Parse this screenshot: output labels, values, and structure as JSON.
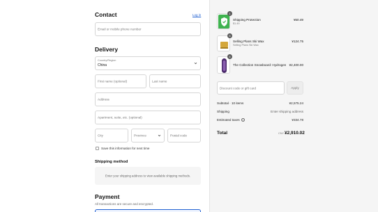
{
  "contact": {
    "heading": "Contact",
    "login_link": "Log in",
    "email_placeholder": "Email or mobile phone number"
  },
  "delivery": {
    "heading": "Delivery",
    "country_label": "Country/Region",
    "country_value": "China",
    "first_name_placeholder": "First name (optional)",
    "last_name_placeholder": "Last name",
    "address_placeholder": "Address",
    "apartment_placeholder": "Apartment, suite, etc. (optional)",
    "city_placeholder": "City",
    "province_placeholder": "Province",
    "postal_placeholder": "Postal code",
    "save_info_label": "Save this information for next time"
  },
  "shipping_method": {
    "heading": "Shipping method",
    "message": "Enter your shipping address to view available shipping methods."
  },
  "payment": {
    "heading": "Payment",
    "subtitle": "All transactions are secure and encrypted."
  },
  "order_summary": {
    "items": [
      {
        "name": "Shipping Protection",
        "variant": "$1.49",
        "quantity": "1",
        "price": "¥50.49",
        "icon": "shield-icon"
      },
      {
        "name": "Selling Plans Ski Wax",
        "variant": "Selling Plans Ski Wax",
        "quantity": "5",
        "price": "¥124.75",
        "icon": "ski-wax-icon"
      },
      {
        "name": "The Collection Snowboard: Hydrogen",
        "variant": "",
        "quantity": "4",
        "price": "¥2,400.00",
        "icon": "snowboard-icon"
      }
    ],
    "discount_placeholder": "Discount code or gift card",
    "apply_label": "Apply",
    "subtotal_label": "Subtotal · 10 items",
    "subtotal_value": "¥2,575.24",
    "shipping_label": "Shipping",
    "shipping_value": "Enter shipping address",
    "taxes_label": "Estimated taxes",
    "taxes_value": "¥334.78",
    "total_label": "Total",
    "total_currency": "CNY",
    "total_value": "¥2,910.02"
  },
  "colors": {
    "link": "#1f5fd1",
    "summary_bg": "#f5f5f5",
    "shield_green": "#3fb34f"
  }
}
